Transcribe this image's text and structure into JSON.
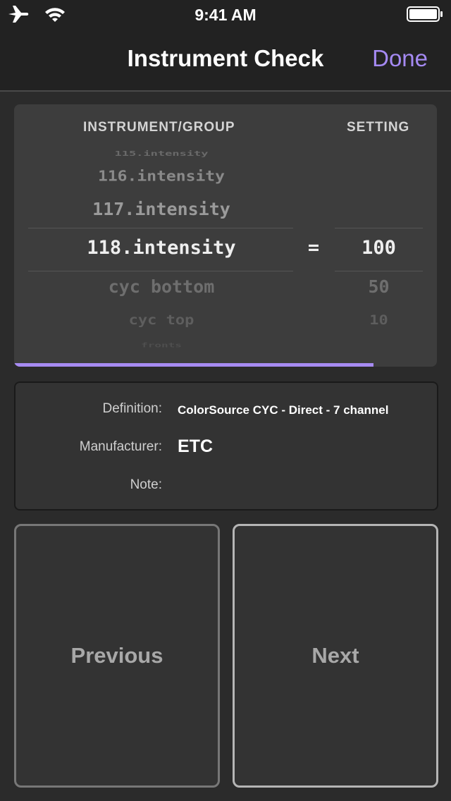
{
  "status_bar": {
    "time": "9:41 AM"
  },
  "nav": {
    "title": "Instrument Check",
    "done_label": "Done"
  },
  "picker": {
    "headers": {
      "instrument": "INSTRUMENT/GROUP",
      "setting": "SETTING"
    },
    "rows": [
      {
        "instrument": "115.intensity",
        "setting": ""
      },
      {
        "instrument": "116.intensity",
        "setting": ""
      },
      {
        "instrument": "117.intensity",
        "setting": ""
      },
      {
        "instrument": "118.intensity",
        "setting": "100"
      },
      {
        "instrument": "cyc bottom",
        "setting": "50"
      },
      {
        "instrument": "cyc top",
        "setting": "10"
      },
      {
        "instrument": "fronts",
        "setting": ""
      }
    ],
    "equals": "=",
    "progress_fraction": 0.85
  },
  "info": {
    "definition_label": "Definition:",
    "definition_value": "ColorSource CYC - Direct - 7 channel",
    "manufacturer_label": "Manufacturer:",
    "manufacturer_value": "ETC",
    "note_label": "Note:",
    "note_value": ""
  },
  "buttons": {
    "previous": "Previous",
    "next": "Next"
  },
  "colors": {
    "accent": "#a58af3",
    "background": "#2b2b2b",
    "bar": "#222222"
  }
}
